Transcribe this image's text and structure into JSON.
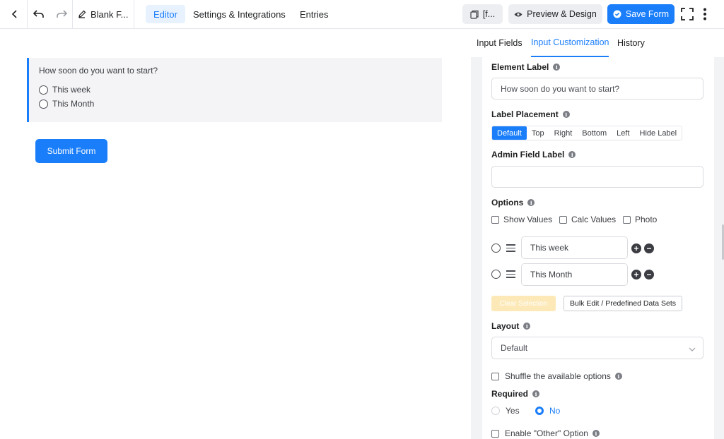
{
  "topbar": {
    "form_title": "Blank F...",
    "tabs": [
      "Editor",
      "Settings & Integrations",
      "Entries"
    ],
    "shortcode_label": "[f...",
    "preview_label": "Preview & Design",
    "save_label": "Save Form"
  },
  "canvas": {
    "question": "How soon do you want to start?",
    "options": [
      "This week",
      "This Month"
    ],
    "submit_label": "Submit Form"
  },
  "panel": {
    "tabs": [
      "Input Fields",
      "Input Customization",
      "History"
    ],
    "element_label": {
      "title": "Element Label",
      "value": "How soon do you want to start?"
    },
    "label_placement": {
      "title": "Label Placement",
      "options": [
        "Default",
        "Top",
        "Right",
        "Bottom",
        "Left",
        "Hide Label"
      ],
      "selected": "Default"
    },
    "admin_label": {
      "title": "Admin Field Label",
      "value": ""
    },
    "options_section": {
      "title": "Options",
      "toggles": [
        "Show Values",
        "Calc Values",
        "Photo"
      ],
      "items": [
        "This week",
        "This Month"
      ],
      "clear_label": "Clear Selection",
      "bulk_label": "Bulk Edit / Predefined Data Sets"
    },
    "layout": {
      "title": "Layout",
      "value": "Default"
    },
    "shuffle_label": "Shuffle the available options",
    "required": {
      "title": "Required",
      "yes": "Yes",
      "no": "No",
      "selected": "No"
    },
    "other_option_label": "Enable \"Other\" Option"
  },
  "colors": {
    "accent": "#1a7efb",
    "clear_button": "#fde9b8"
  }
}
